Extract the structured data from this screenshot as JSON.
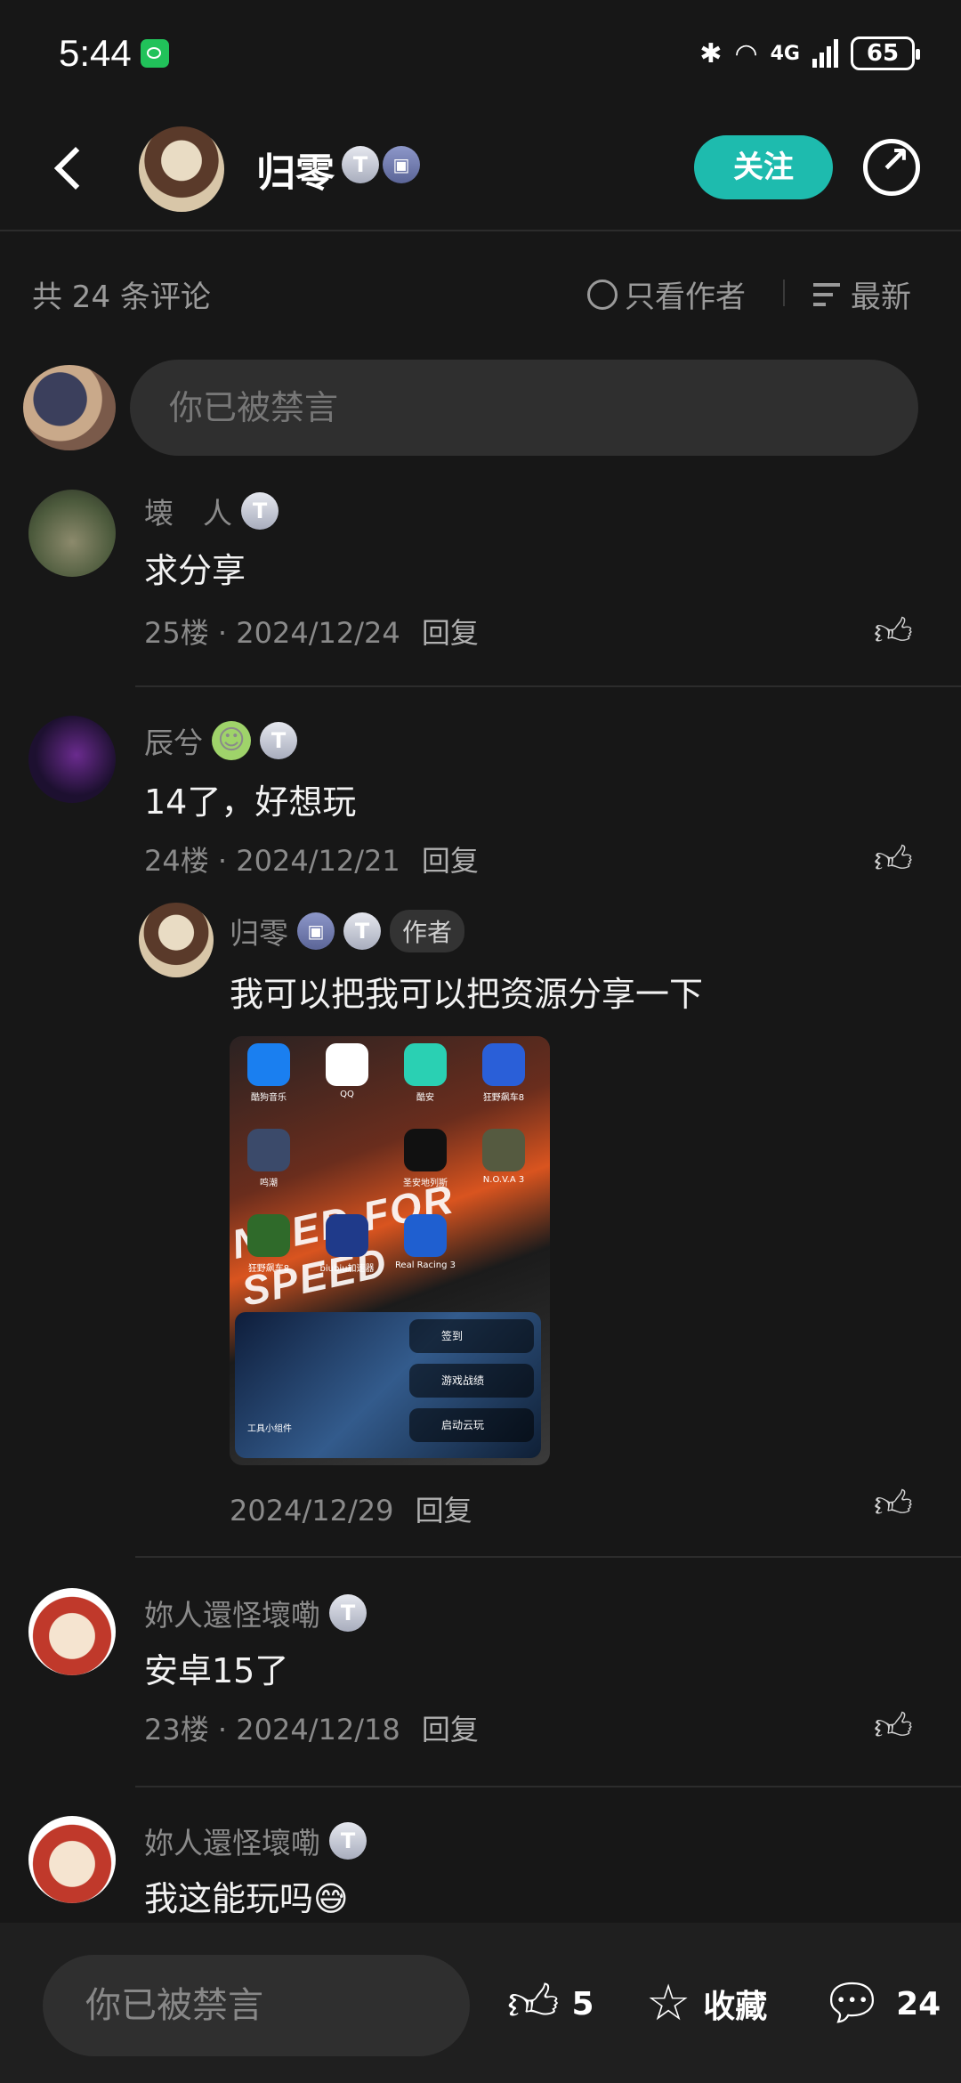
{
  "status_bar": {
    "time": "5:44",
    "network": "4G",
    "battery": "65"
  },
  "header": {
    "name": "归零",
    "follow_label": "关注"
  },
  "filter": {
    "count_label": "共 24 条评论",
    "only_author_label": "只看作者",
    "sort_label": "最新"
  },
  "composer": {
    "placeholder": "你已被禁言"
  },
  "comments": [
    {
      "name": "壊　人",
      "text": "求分享",
      "floor": "25楼",
      "date": "2024/12/24",
      "reply": "回复"
    },
    {
      "name": "辰兮",
      "text": "14了，好想玩",
      "floor": "24楼",
      "date": "2024/12/21",
      "reply": "回复",
      "sub_reply": {
        "name": "归零",
        "author_tag": "作者",
        "text": "我可以把我可以把资源分享一下",
        "date": "2024/12/29",
        "reply": "回复"
      }
    },
    {
      "name": "妳人還怪壞嘞",
      "text": "安卓15了",
      "floor": "23楼",
      "date": "2024/12/18",
      "reply": "回复"
    },
    {
      "name": "妳人還怪壞嘞",
      "text": "我这能玩吗",
      "emoji": "😅"
    }
  ],
  "thumbnail": {
    "apps": [
      "酷狗音乐",
      "QQ",
      "酷安",
      "狂野飙车8",
      "鸣潮",
      "圣安地列斯",
      "N.O.V.A 3",
      "狂野飙车8",
      "biubiu加速器",
      "Real Racing 3"
    ],
    "banner": "NEED FOR SPEED",
    "widget_label": "工具小组件",
    "pills": [
      "签到",
      "游戏战绩",
      "启动云玩"
    ]
  },
  "bottom_bar": {
    "input_placeholder": "你已被禁言",
    "like_count": "5",
    "collect_label": "收藏",
    "comment_count": "24"
  }
}
